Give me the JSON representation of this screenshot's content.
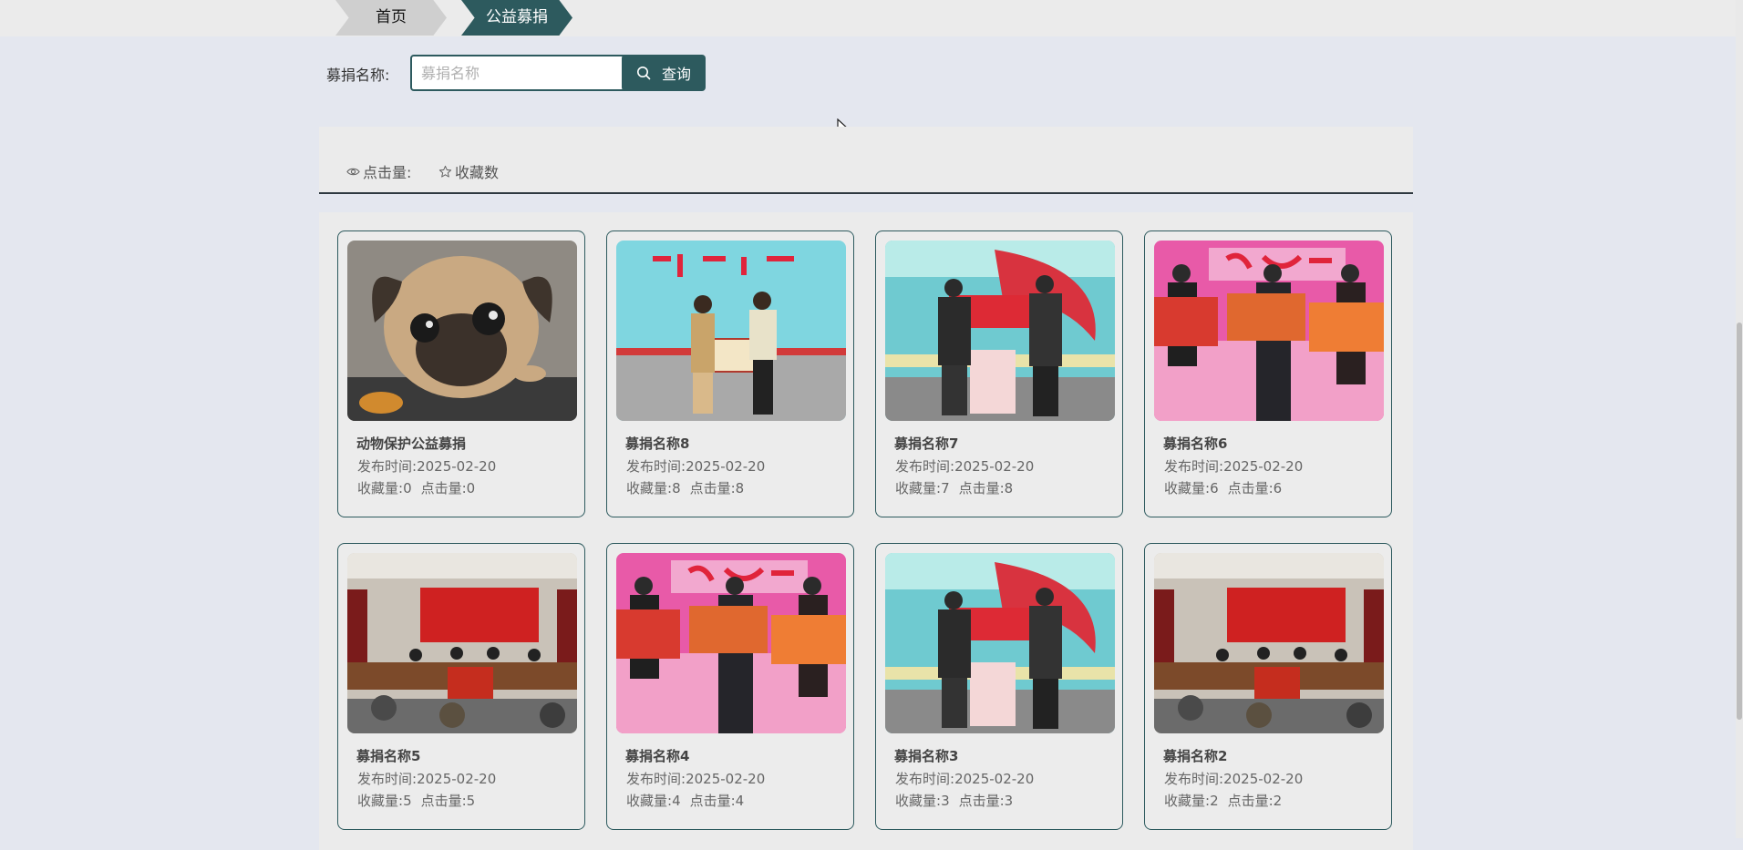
{
  "breadcrumb": {
    "home": "首页",
    "current": "公益募捐"
  },
  "search": {
    "label": "募捐名称:",
    "placeholder": "募捐名称",
    "value": "",
    "button_label": "查询",
    "button_icon": "search-icon"
  },
  "stats": {
    "clicks_label": "点击量:",
    "favorites_label": "收藏数",
    "clicks_icon": "eye-icon",
    "favorites_icon": "star-icon"
  },
  "theme": {
    "accent": "#2d5a5e"
  },
  "cards": [
    {
      "title": "动物保护公益募捐",
      "publish_label": "发布时间:",
      "date": "2025-02-20",
      "fav_label": "收藏量:",
      "favs": "0",
      "click_label": "点击量:",
      "clicks": "0",
      "image": "pug-dog-photo"
    },
    {
      "title": "募捐名称8",
      "publish_label": "发布时间:",
      "date": "2025-02-20",
      "fav_label": "收藏量:",
      "favs": "8",
      "click_label": "点击量:",
      "clicks": "8",
      "image": "donation-ceremony-photo"
    },
    {
      "title": "募捐名称7",
      "publish_label": "发布时间:",
      "date": "2025-02-20",
      "fav_label": "收藏量:",
      "favs": "7",
      "click_label": "点击量:",
      "clicks": "8",
      "image": "epidemic-donation-photo"
    },
    {
      "title": "募捐名称6",
      "publish_label": "发布时间:",
      "date": "2025-02-20",
      "fav_label": "收藏量:",
      "favs": "6",
      "click_label": "点击量:",
      "clicks": "6",
      "image": "charity-stage-photo"
    },
    {
      "title": "募捐名称5",
      "publish_label": "发布时间:",
      "date": "2025-02-20",
      "fav_label": "收藏量:",
      "favs": "5",
      "click_label": "点击量:",
      "clicks": "5",
      "image": "meeting-hall-photo"
    },
    {
      "title": "募捐名称4",
      "publish_label": "发布时间:",
      "date": "2025-02-20",
      "fav_label": "收藏量:",
      "favs": "4",
      "click_label": "点击量:",
      "clicks": "4",
      "image": "charity-stage-photo"
    },
    {
      "title": "募捐名称3",
      "publish_label": "发布时间:",
      "date": "2025-02-20",
      "fav_label": "收藏量:",
      "favs": "3",
      "click_label": "点击量:",
      "clicks": "3",
      "image": "epidemic-donation-photo"
    },
    {
      "title": "募捐名称2",
      "publish_label": "发布时间:",
      "date": "2025-02-20",
      "fav_label": "收藏量:",
      "favs": "2",
      "click_label": "点击量:",
      "clicks": "2",
      "image": "meeting-hall-photo"
    }
  ]
}
